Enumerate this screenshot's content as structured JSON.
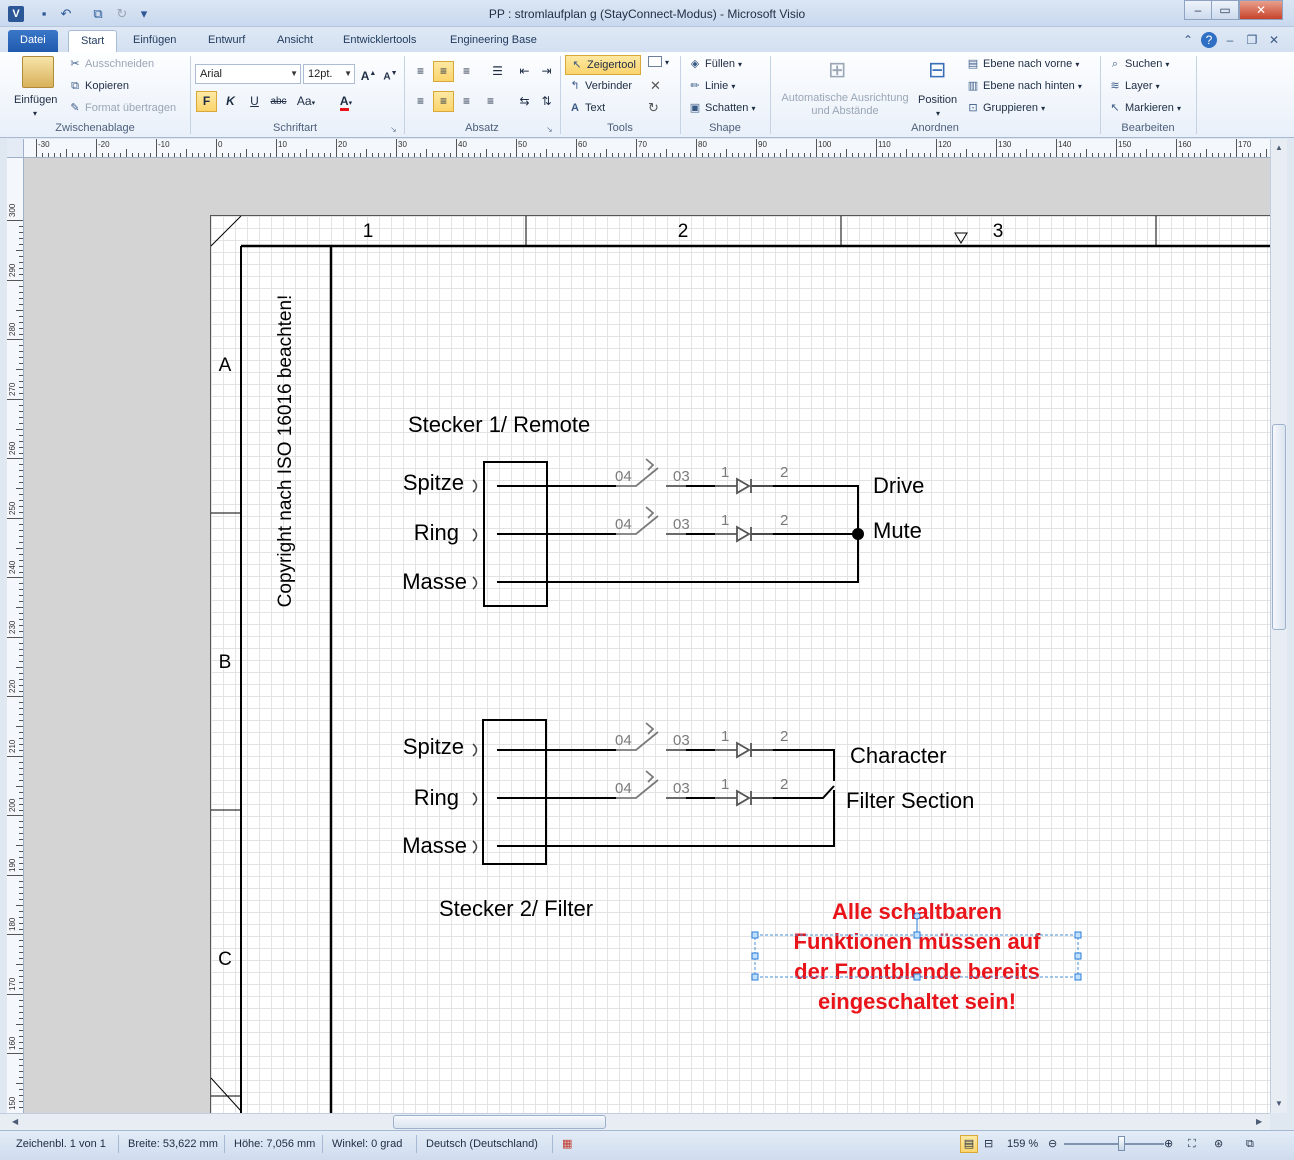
{
  "window": {
    "title": "PP : stromlaufplan g (StayConnect-Modus)  -  Microsoft Visio",
    "app_icon": "V",
    "minimize": "–",
    "maximize": "▭",
    "close": "✕"
  },
  "tabs": {
    "datei": "Datei",
    "start": "Start",
    "einfuegen": "Einfügen",
    "entwurf": "Entwurf",
    "ansicht": "Ansicht",
    "entwicklertools": "Entwicklertools",
    "engineering_base": "Engineering Base"
  },
  "ribbon": {
    "clipboard": {
      "paste": "Einfügen",
      "cut": "Ausschneiden",
      "copy": "Kopieren",
      "format_painter": "Format übertragen",
      "label": "Zwischenablage"
    },
    "font": {
      "family": "Arial",
      "size": "12pt.",
      "bold": "F",
      "italic": "K",
      "underline": "U",
      "strike": "abc",
      "case": "Aa",
      "color": "A",
      "label": "Schriftart"
    },
    "paragraph": {
      "label": "Absatz"
    },
    "tools": {
      "pointer": "Zeigertool",
      "connector": "Verbinder",
      "text": "Text",
      "label": "Tools"
    },
    "shape": {
      "fill": "Füllen",
      "line": "Linie",
      "shadow": "Schatten",
      "label": "Shape"
    },
    "arrange": {
      "auto_align": "Automatische Ausrichtung",
      "auto_align_2": "und Abstände",
      "position": "Position",
      "bring_front": "Ebene nach vorne",
      "send_back": "Ebene nach hinten",
      "group": "Gruppieren",
      "label": "Anordnen"
    },
    "editing": {
      "find": "Suchen",
      "layer": "Layer",
      "select": "Markieren",
      "label": "Bearbeiten"
    }
  },
  "ruler_top": [
    "-30",
    "-20",
    "-10",
    "0",
    "10",
    "20",
    "30",
    "40",
    "50",
    "60",
    "70",
    "80",
    "90",
    "100",
    "110",
    "120",
    "130",
    "140",
    "150",
    "160",
    "170"
  ],
  "ruler_left": [
    "300",
    "290",
    "280",
    "270",
    "260",
    "250",
    "240",
    "230",
    "220",
    "210",
    "200",
    "190",
    "180",
    "170",
    "160",
    "150"
  ],
  "drawing": {
    "columns": [
      "1",
      "2",
      "3"
    ],
    "rows": [
      "A",
      "B",
      "C"
    ],
    "copyright": "Copyright nach ISO 16016 beachten!",
    "connector1": {
      "title": "Stecker 1/ Remote",
      "pins": [
        "Spitze",
        "Ring",
        "Masse"
      ],
      "outputs": [
        "Drive",
        "Mute"
      ]
    },
    "connector2": {
      "title": "Stecker 2/ Filter",
      "pins": [
        "Spitze",
        "Ring",
        "Masse"
      ],
      "outputs": [
        "Character",
        "Filter Section"
      ]
    },
    "switch_labels": [
      "04",
      "03"
    ],
    "diode_labels": [
      "1",
      "2"
    ],
    "note": [
      "Alle schaltbaren",
      "Funktionen müssen auf",
      "der Frontblende bereits",
      "eingeschaltet sein!"
    ],
    "colors": {
      "note": "#e8141a",
      "wire": "#000000",
      "switch": "#7a7a7a"
    }
  },
  "status": {
    "page": "Zeichenbl. 1 von 1",
    "width": "Breite: 53,622 mm",
    "height": "Höhe: 7,056 mm",
    "angle": "Winkel: 0 grad",
    "language": "Deutsch (Deutschland)",
    "zoom": "159 %"
  }
}
